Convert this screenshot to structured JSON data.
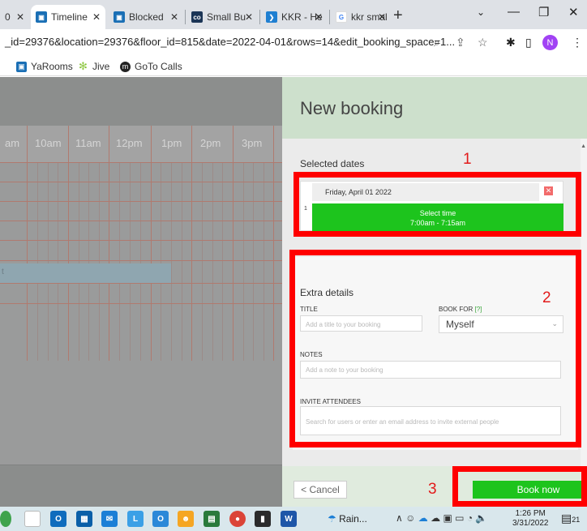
{
  "browser": {
    "tabs": [
      {
        "label": "0",
        "active": false
      },
      {
        "label": "Timeline",
        "active": true
      },
      {
        "label": "Blocked",
        "active": false
      },
      {
        "label": "Small Bu",
        "active": false
      },
      {
        "label": "KKR - He",
        "active": false
      },
      {
        "label": "kkr smal",
        "active": false
      }
    ],
    "url": "_id=29376&location=29376&floor_id=815&date=2022-04-01&rows=14&edit_booking_space=1...",
    "profile_initial": "N",
    "bookmarks": [
      "YaRooms",
      "Jive",
      "GoTo Calls"
    ]
  },
  "timeline": {
    "hours": [
      "am",
      "10am",
      "11am",
      "12pm",
      "1pm",
      "2pm",
      "3pm"
    ],
    "bar_label": "t"
  },
  "booking": {
    "title": "New booking",
    "selected_dates_label": "Selected dates",
    "date": "Friday, April 01 2022",
    "delete_symbol": "✕",
    "row_number": "1",
    "select_time_label": "Select time",
    "time_range": "7:00am - 7:15am",
    "extra_details_label": "Extra details",
    "title_label": "TITLE",
    "title_placeholder": "Add a title to your booking",
    "book_for_label": "BOOK FOR",
    "book_for_help": "[?]",
    "book_for_value": "Myself",
    "notes_label": "NOTES",
    "notes_placeholder": "Add a note to your booking",
    "invite_label": "INVITE ATTENDEES",
    "invite_placeholder": "Search for users or enter an email address to invite external people",
    "cancel_label": "< Cancel",
    "book_now_label": "Book now"
  },
  "annotations": [
    "1",
    "2",
    "3"
  ],
  "taskbar": {
    "weather": "Rain...",
    "time": "1:26 PM",
    "date": "3/31/2022",
    "notif_count": "21"
  },
  "colors": {
    "green": "#1dc41d",
    "panel_header": "#cde0cc",
    "annotation_red": "#ff0000"
  }
}
